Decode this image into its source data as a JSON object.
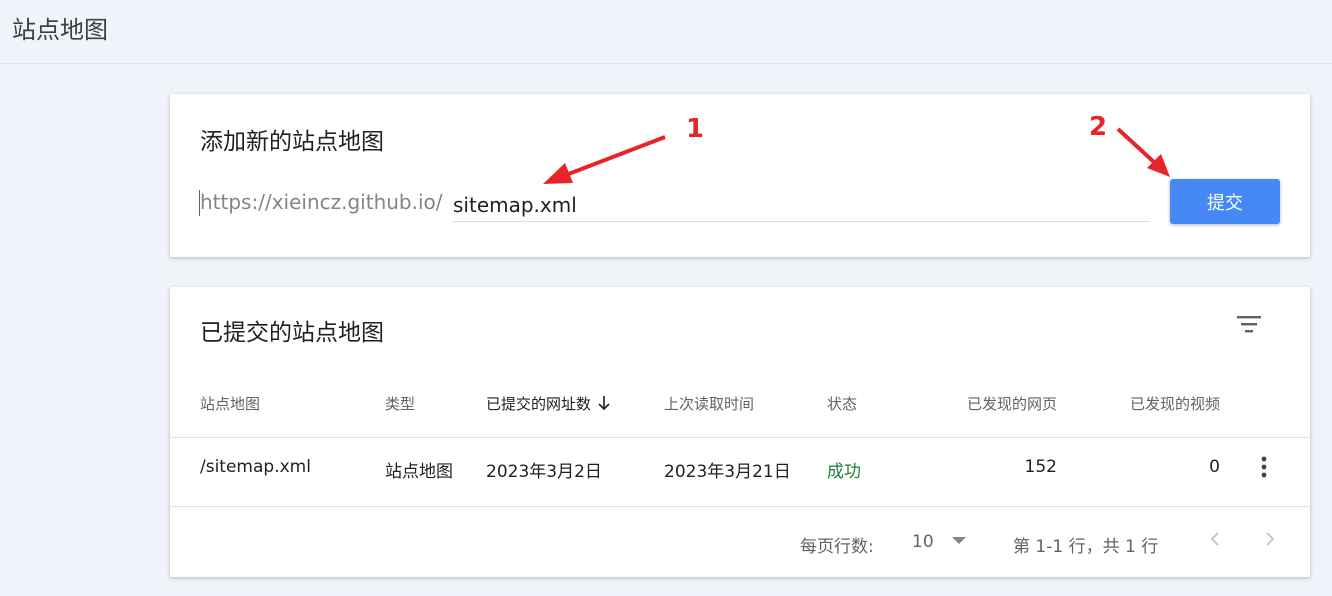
{
  "page": {
    "title": "站点地图"
  },
  "add_card": {
    "title": "添加新的站点地图",
    "url_prefix": "https://xieincz.github.io/",
    "input_value": "sitemap.xml",
    "submit_label": "提交"
  },
  "list_card": {
    "title": "已提交的站点地图",
    "filter_icon": "filter-list-icon",
    "columns": [
      "站点地图",
      "类型",
      "已提交的网址数",
      "上次读取时间",
      "状态",
      "已发现的网页",
      "已发现的视频"
    ],
    "sort_icon": "arrow-down-icon",
    "rows": [
      {
        "sitemap": "/sitemap.xml",
        "type": "站点地图",
        "submitted": "2023年3月2日",
        "last_read": "2023年3月21日",
        "status": "成功",
        "pages": "152",
        "videos": "0"
      }
    ],
    "footer": {
      "rows_per_page_label": "每页行数:",
      "rows_per_page_value": "10",
      "range_text": "第 1-1 行，共 1 行"
    }
  },
  "annotations": [
    "1",
    "2"
  ],
  "colors": {
    "background": "#f1f3fa",
    "submit_button": "#4688f4",
    "status_success": "#188038",
    "annotation": "#e8232a"
  }
}
